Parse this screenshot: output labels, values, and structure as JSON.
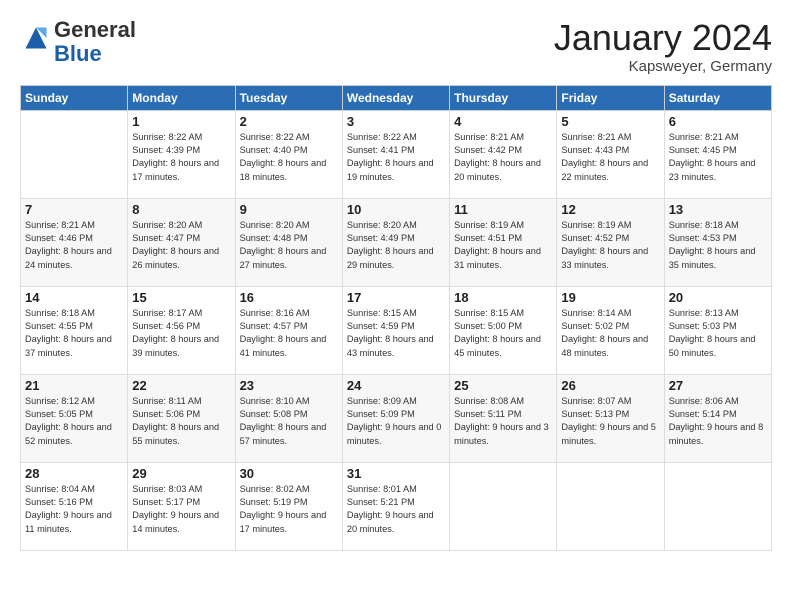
{
  "header": {
    "logo_general": "General",
    "logo_blue": "Blue",
    "month_title": "January 2024",
    "location": "Kapsweyer, Germany"
  },
  "days_of_week": [
    "Sunday",
    "Monday",
    "Tuesday",
    "Wednesday",
    "Thursday",
    "Friday",
    "Saturday"
  ],
  "weeks": [
    [
      {
        "day": "",
        "sunrise": "",
        "sunset": "",
        "daylight": ""
      },
      {
        "day": "1",
        "sunrise": "Sunrise: 8:22 AM",
        "sunset": "Sunset: 4:39 PM",
        "daylight": "Daylight: 8 hours and 17 minutes."
      },
      {
        "day": "2",
        "sunrise": "Sunrise: 8:22 AM",
        "sunset": "Sunset: 4:40 PM",
        "daylight": "Daylight: 8 hours and 18 minutes."
      },
      {
        "day": "3",
        "sunrise": "Sunrise: 8:22 AM",
        "sunset": "Sunset: 4:41 PM",
        "daylight": "Daylight: 8 hours and 19 minutes."
      },
      {
        "day": "4",
        "sunrise": "Sunrise: 8:21 AM",
        "sunset": "Sunset: 4:42 PM",
        "daylight": "Daylight: 8 hours and 20 minutes."
      },
      {
        "day": "5",
        "sunrise": "Sunrise: 8:21 AM",
        "sunset": "Sunset: 4:43 PM",
        "daylight": "Daylight: 8 hours and 22 minutes."
      },
      {
        "day": "6",
        "sunrise": "Sunrise: 8:21 AM",
        "sunset": "Sunset: 4:45 PM",
        "daylight": "Daylight: 8 hours and 23 minutes."
      }
    ],
    [
      {
        "day": "7",
        "sunrise": "Sunrise: 8:21 AM",
        "sunset": "Sunset: 4:46 PM",
        "daylight": "Daylight: 8 hours and 24 minutes."
      },
      {
        "day": "8",
        "sunrise": "Sunrise: 8:20 AM",
        "sunset": "Sunset: 4:47 PM",
        "daylight": "Daylight: 8 hours and 26 minutes."
      },
      {
        "day": "9",
        "sunrise": "Sunrise: 8:20 AM",
        "sunset": "Sunset: 4:48 PM",
        "daylight": "Daylight: 8 hours and 27 minutes."
      },
      {
        "day": "10",
        "sunrise": "Sunrise: 8:20 AM",
        "sunset": "Sunset: 4:49 PM",
        "daylight": "Daylight: 8 hours and 29 minutes."
      },
      {
        "day": "11",
        "sunrise": "Sunrise: 8:19 AM",
        "sunset": "Sunset: 4:51 PM",
        "daylight": "Daylight: 8 hours and 31 minutes."
      },
      {
        "day": "12",
        "sunrise": "Sunrise: 8:19 AM",
        "sunset": "Sunset: 4:52 PM",
        "daylight": "Daylight: 8 hours and 33 minutes."
      },
      {
        "day": "13",
        "sunrise": "Sunrise: 8:18 AM",
        "sunset": "Sunset: 4:53 PM",
        "daylight": "Daylight: 8 hours and 35 minutes."
      }
    ],
    [
      {
        "day": "14",
        "sunrise": "Sunrise: 8:18 AM",
        "sunset": "Sunset: 4:55 PM",
        "daylight": "Daylight: 8 hours and 37 minutes."
      },
      {
        "day": "15",
        "sunrise": "Sunrise: 8:17 AM",
        "sunset": "Sunset: 4:56 PM",
        "daylight": "Daylight: 8 hours and 39 minutes."
      },
      {
        "day": "16",
        "sunrise": "Sunrise: 8:16 AM",
        "sunset": "Sunset: 4:57 PM",
        "daylight": "Daylight: 8 hours and 41 minutes."
      },
      {
        "day": "17",
        "sunrise": "Sunrise: 8:15 AM",
        "sunset": "Sunset: 4:59 PM",
        "daylight": "Daylight: 8 hours and 43 minutes."
      },
      {
        "day": "18",
        "sunrise": "Sunrise: 8:15 AM",
        "sunset": "Sunset: 5:00 PM",
        "daylight": "Daylight: 8 hours and 45 minutes."
      },
      {
        "day": "19",
        "sunrise": "Sunrise: 8:14 AM",
        "sunset": "Sunset: 5:02 PM",
        "daylight": "Daylight: 8 hours and 48 minutes."
      },
      {
        "day": "20",
        "sunrise": "Sunrise: 8:13 AM",
        "sunset": "Sunset: 5:03 PM",
        "daylight": "Daylight: 8 hours and 50 minutes."
      }
    ],
    [
      {
        "day": "21",
        "sunrise": "Sunrise: 8:12 AM",
        "sunset": "Sunset: 5:05 PM",
        "daylight": "Daylight: 8 hours and 52 minutes."
      },
      {
        "day": "22",
        "sunrise": "Sunrise: 8:11 AM",
        "sunset": "Sunset: 5:06 PM",
        "daylight": "Daylight: 8 hours and 55 minutes."
      },
      {
        "day": "23",
        "sunrise": "Sunrise: 8:10 AM",
        "sunset": "Sunset: 5:08 PM",
        "daylight": "Daylight: 8 hours and 57 minutes."
      },
      {
        "day": "24",
        "sunrise": "Sunrise: 8:09 AM",
        "sunset": "Sunset: 5:09 PM",
        "daylight": "Daylight: 9 hours and 0 minutes."
      },
      {
        "day": "25",
        "sunrise": "Sunrise: 8:08 AM",
        "sunset": "Sunset: 5:11 PM",
        "daylight": "Daylight: 9 hours and 3 minutes."
      },
      {
        "day": "26",
        "sunrise": "Sunrise: 8:07 AM",
        "sunset": "Sunset: 5:13 PM",
        "daylight": "Daylight: 9 hours and 5 minutes."
      },
      {
        "day": "27",
        "sunrise": "Sunrise: 8:06 AM",
        "sunset": "Sunset: 5:14 PM",
        "daylight": "Daylight: 9 hours and 8 minutes."
      }
    ],
    [
      {
        "day": "28",
        "sunrise": "Sunrise: 8:04 AM",
        "sunset": "Sunset: 5:16 PM",
        "daylight": "Daylight: 9 hours and 11 minutes."
      },
      {
        "day": "29",
        "sunrise": "Sunrise: 8:03 AM",
        "sunset": "Sunset: 5:17 PM",
        "daylight": "Daylight: 9 hours and 14 minutes."
      },
      {
        "day": "30",
        "sunrise": "Sunrise: 8:02 AM",
        "sunset": "Sunset: 5:19 PM",
        "daylight": "Daylight: 9 hours and 17 minutes."
      },
      {
        "day": "31",
        "sunrise": "Sunrise: 8:01 AM",
        "sunset": "Sunset: 5:21 PM",
        "daylight": "Daylight: 9 hours and 20 minutes."
      },
      {
        "day": "",
        "sunrise": "",
        "sunset": "",
        "daylight": ""
      },
      {
        "day": "",
        "sunrise": "",
        "sunset": "",
        "daylight": ""
      },
      {
        "day": "",
        "sunrise": "",
        "sunset": "",
        "daylight": ""
      }
    ]
  ]
}
